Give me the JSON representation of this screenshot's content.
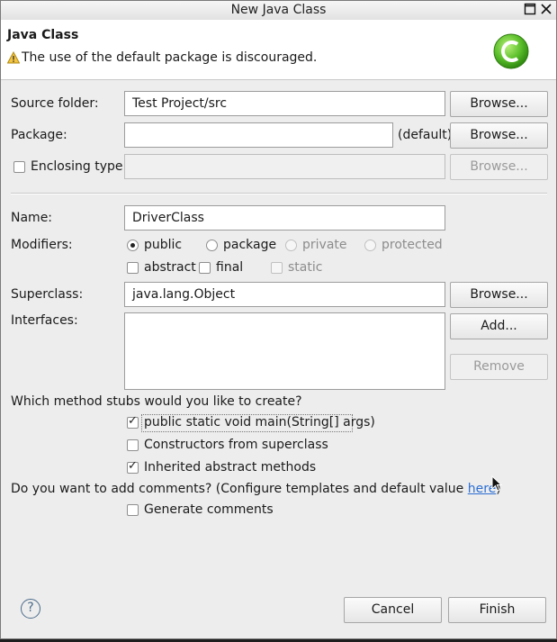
{
  "window": {
    "title": "New Java Class",
    "maximize_icon": "maximize-icon",
    "close_icon": "close-icon"
  },
  "header": {
    "title": "Java Class",
    "warning": "The use of the default package is discouraged.",
    "warning_icon": "warning-icon",
    "wizard_icon": "java-class-icon"
  },
  "form": {
    "source_folder": {
      "label": "Source folder:",
      "value": "Test Project/src",
      "browse": "Browse..."
    },
    "package": {
      "label": "Package:",
      "value": "",
      "default_label": "(default)",
      "browse": "Browse..."
    },
    "enclosing_type": {
      "label": "Enclosing type:",
      "checked": false,
      "value": "",
      "browse": "Browse..."
    },
    "name": {
      "label": "Name:",
      "value": "DriverClass"
    },
    "modifiers": {
      "label": "Modifiers:",
      "radios": [
        {
          "label": "public",
          "checked": true,
          "enabled": true
        },
        {
          "label": "package",
          "checked": false,
          "enabled": true
        },
        {
          "label": "private",
          "checked": false,
          "enabled": false
        },
        {
          "label": "protected",
          "checked": false,
          "enabled": false
        }
      ],
      "checks": [
        {
          "label": "abstract",
          "checked": false,
          "enabled": true
        },
        {
          "label": "final",
          "checked": false,
          "enabled": true
        },
        {
          "label": "static",
          "checked": false,
          "enabled": false
        }
      ]
    },
    "superclass": {
      "label": "Superclass:",
      "value": "java.lang.Object",
      "browse": "Browse..."
    },
    "interfaces": {
      "label": "Interfaces:",
      "add": "Add...",
      "remove": "Remove"
    },
    "stubs": {
      "question": "Which method stubs would you like to create?",
      "options": [
        {
          "label": "public static void main(String[] args)",
          "checked": true
        },
        {
          "label": "Constructors from superclass",
          "checked": false
        },
        {
          "label": "Inherited abstract methods",
          "checked": true
        }
      ]
    },
    "comments": {
      "question_prefix": "Do you want to add comments? (Configure templates and default value ",
      "link": "here",
      "question_suffix": ")",
      "generate": {
        "label": "Generate comments",
        "checked": false
      }
    }
  },
  "footer": {
    "help_icon": "help-icon",
    "cancel": "Cancel",
    "finish": "Finish"
  }
}
